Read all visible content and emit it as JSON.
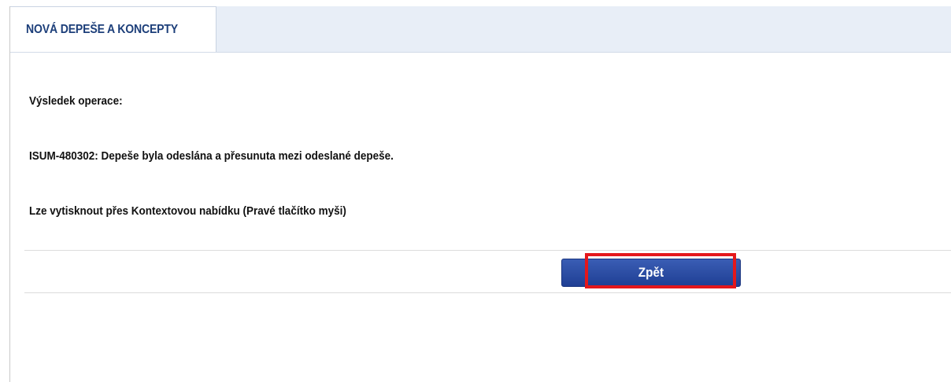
{
  "tab": {
    "label": "NOVÁ DEPEŠE A KONCEPTY"
  },
  "result": {
    "heading": "Výsledek operace:",
    "message": "ISUM-480302: Depeše byla odeslána a přesunuta mezi odeslané depeše.",
    "hint": "Lze vytisknout přes Kontextovou nabídku (Pravé tlačítko myši)"
  },
  "actions": {
    "back_label": "Zpět"
  },
  "colors": {
    "tab_text": "#1d3f7a",
    "button_bg": "#2a4ba3",
    "highlight": "#e4171b"
  }
}
